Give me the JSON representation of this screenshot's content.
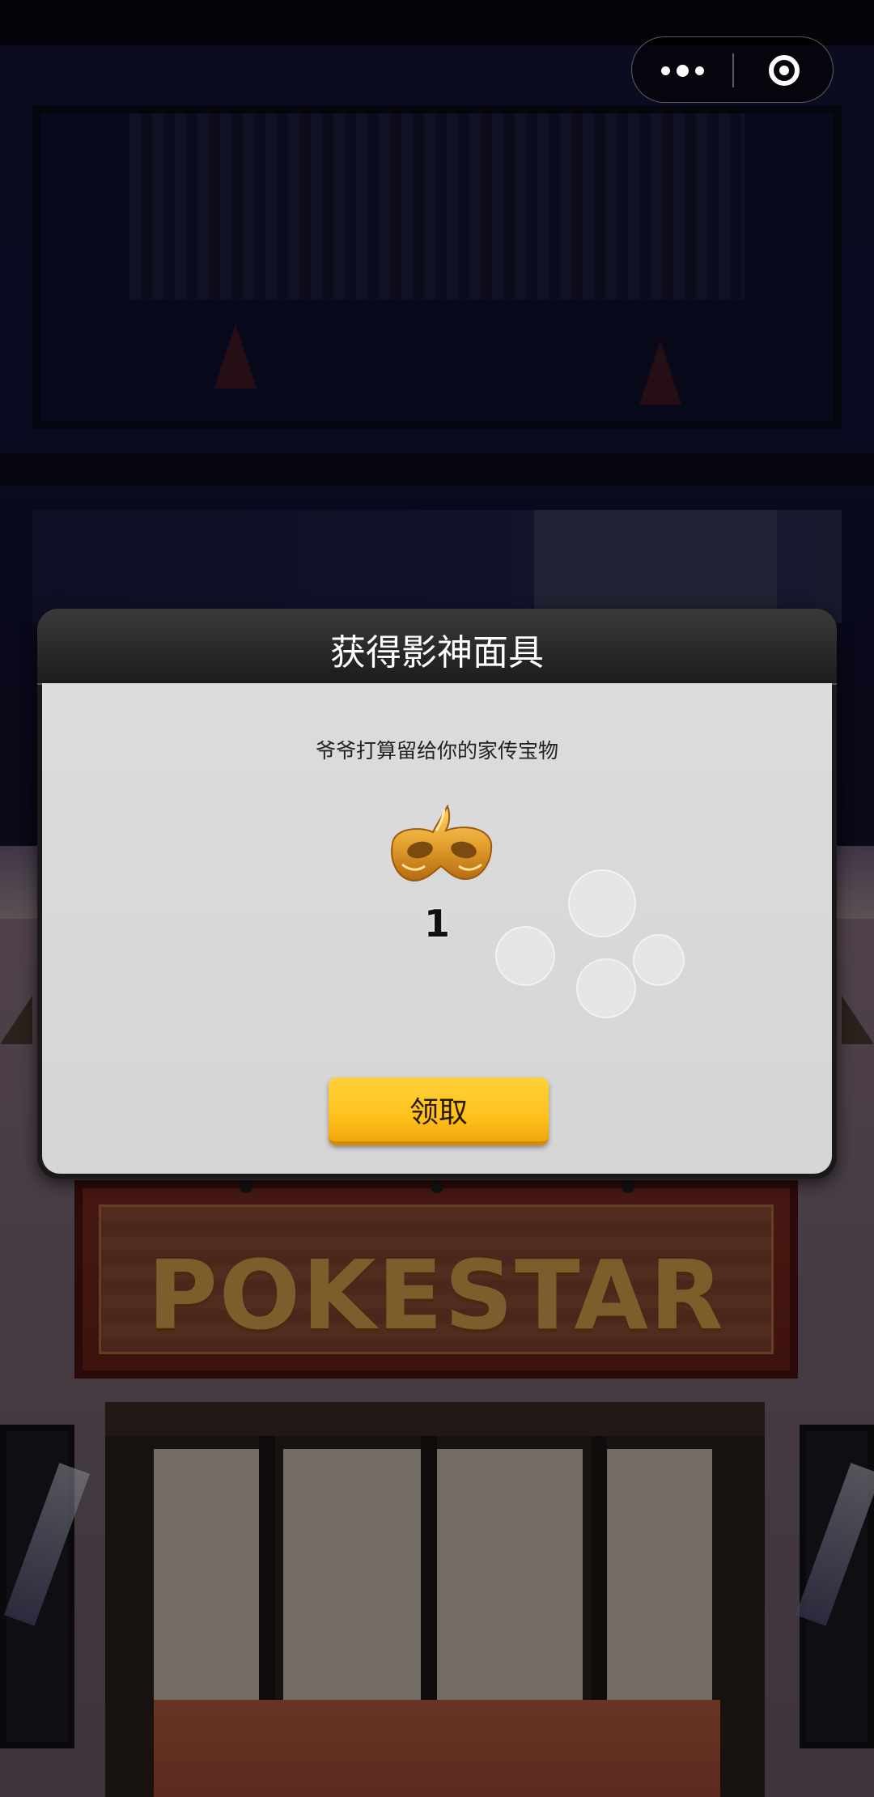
{
  "capsule": {
    "more_icon": "more-dots-icon",
    "close_icon": "target-circle-icon"
  },
  "background": {
    "store_sign": "POKESTAR"
  },
  "dialog": {
    "title": "获得影神面具",
    "subtitle": "爷爷打算留给你的家传宝物",
    "reward": {
      "icon": "golden-mask-icon",
      "count": "1"
    },
    "claim_button_label": "领取"
  },
  "colors": {
    "button_yellow": "#ffc21c",
    "dialog_header": "#2a2a2a",
    "dialog_body": "#d8d8d8",
    "mask_gold": "#e0a030"
  }
}
